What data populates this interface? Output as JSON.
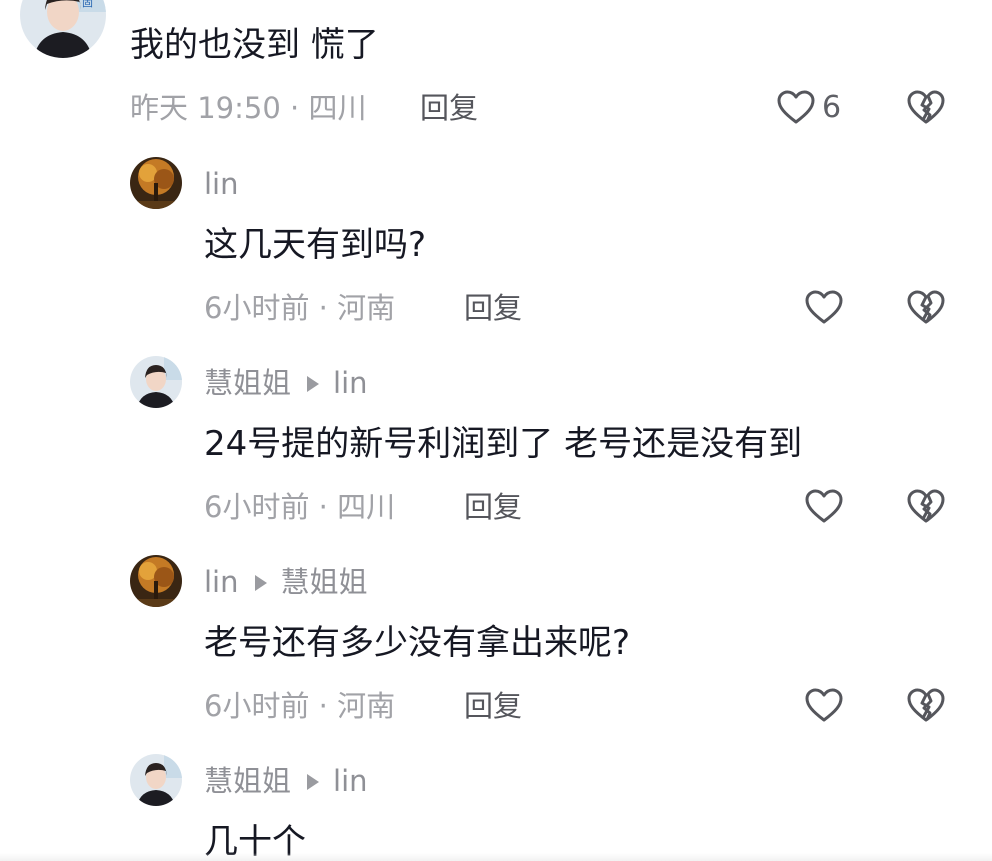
{
  "comments": [
    {
      "avatar": "avatar-photo-woman",
      "content": "我的也没到 慌了",
      "time_location": "昨天 19:50 · 四川",
      "reply_label": "回复",
      "like_count": "6",
      "like_icon": "heart-outline-icon",
      "dislike_icon": "broken-heart-icon"
    }
  ],
  "replies": [
    {
      "avatar": "avatar-photo-autumn-tree",
      "author": "lin",
      "reply_to": "",
      "content": "这几天有到吗?",
      "time_location": "6小时前 · 河南",
      "reply_label": "回复"
    },
    {
      "avatar": "avatar-photo-woman",
      "author": "慧姐姐",
      "reply_to": "lin",
      "content": "24号提的新号利润到了 老号还是没有到",
      "time_location": "6小时前 · 四川",
      "reply_label": "回复"
    },
    {
      "avatar": "avatar-photo-autumn-tree",
      "author": "lin",
      "reply_to": "慧姐姐",
      "content": "老号还有多少没有拿出来呢?",
      "time_location": "6小时前 · 河南",
      "reply_label": "回复"
    },
    {
      "avatar": "avatar-photo-woman",
      "author": "慧姐姐",
      "reply_to": "lin",
      "content": "几十个",
      "time_location": "",
      "reply_label": ""
    }
  ],
  "colors": {
    "primary_text": "#161823",
    "secondary_text": "#8f9096",
    "meta_text": "#a1a2a7",
    "icon": "#55565c"
  }
}
